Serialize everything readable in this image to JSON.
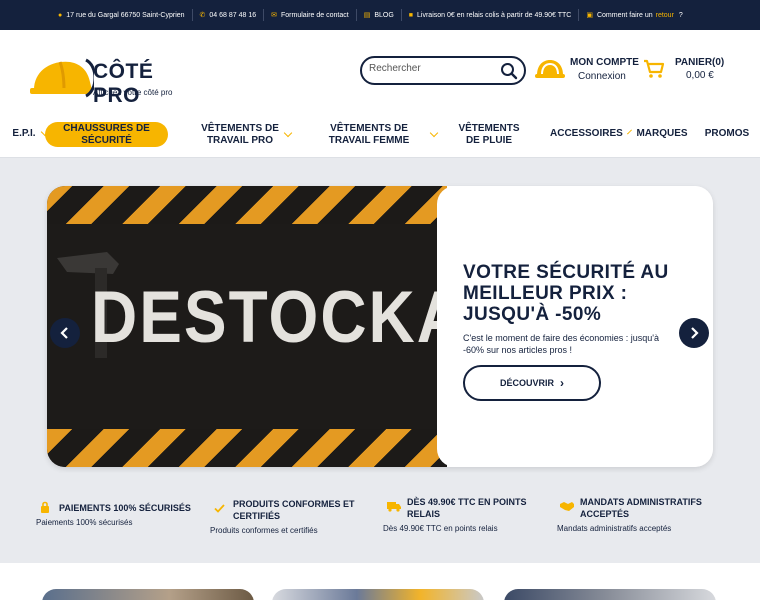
{
  "topbar": {
    "address": "17 rue du Gargal 66750 Saint-Cyprien",
    "phone": "04 68 87 48 16",
    "contact": "Formulaire de contact",
    "blog": "BLOG",
    "shipping": "Livraison 0€  en relais colis à partir de 49.90€ TTC",
    "return_prefix": "Comment faire un",
    "return_link": "retour",
    "return_q": "?"
  },
  "header": {
    "logo_name": "CÔTÉ PRO",
    "logo_tagline": "Affichez votre côté pro",
    "search_placeholder": "Rechercher",
    "account_title": "MON COMPTE",
    "account_sub": "Connexion",
    "cart_title": "PANIER(0)",
    "cart_total": "0,00 €"
  },
  "nav": {
    "epi": "E.P.I.",
    "chaussures": "CHAUSSURES DE SÉCURITÉ",
    "vetements_pro": "VÊTEMENTS DE TRAVAIL PRO",
    "vetements_femme": "VÊTEMENTS DE TRAVAIL FEMME",
    "vetements_pluie": "VÊTEMENTS DE PLUIE",
    "accessoires": "ACCESSOIRES",
    "marques": "MARQUES",
    "promos": "PROMOS"
  },
  "hero": {
    "image_word": "DESTOCKAGE",
    "title": "VOTRE SÉCURITÉ AU MEILLEUR PRIX : JUSQU'À -50%",
    "text": "C'est le moment de faire des économies : jusqu'à -60% sur nos articles pros !",
    "button": "DÉCOUVRIR",
    "button_arrow": "›",
    "prev": "‹",
    "next": "›"
  },
  "reassurance": [
    {
      "title": "PAIEMENTS 100% SÉCURISÉS",
      "sub": "Paiements 100% sécurisés",
      "icon": "lock-icon"
    },
    {
      "title": "PRODUITS CONFORMES ET CERTIFIÉS",
      "sub": "Produits conformes et certifiés",
      "icon": "check-icon"
    },
    {
      "title": "DÈS 49.90€ TTC EN POINTS RELAIS",
      "sub": "Dès 49.90€ TTC en points relais",
      "icon": "truck-icon"
    },
    {
      "title": "MANDATS ADMINISTRATIFS ACCEPTÉS",
      "sub": "Mandats administratifs acceptés",
      "icon": "handshake-icon"
    }
  ],
  "colors": {
    "navy": "#14213d",
    "yellow": "#f7b500",
    "background": "#e8eaee"
  }
}
